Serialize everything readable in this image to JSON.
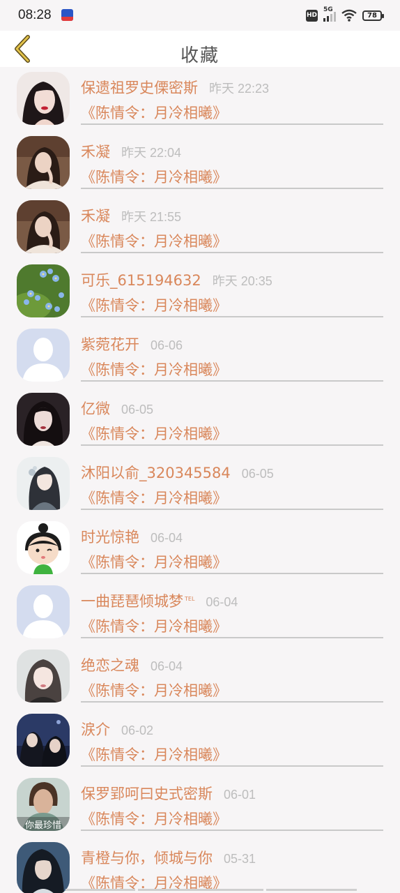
{
  "status_bar": {
    "time": "08:28",
    "hd": "HD",
    "network": "5G",
    "battery": "78"
  },
  "nav": {
    "title": "收藏",
    "back_icon": "chevron-left-icon",
    "back_color": "#d4b13c"
  },
  "colors": {
    "accent": "#d9875b",
    "time_gray": "#bdbdbd",
    "divider": "#c9c9c9"
  },
  "favorites": [
    {
      "name": "保遗祖罗史傈密斯",
      "time": "昨天 22:23",
      "title": "《陈情令：月冷相曦》",
      "avatar": "photo-woman-red-lips"
    },
    {
      "name": "禾凝",
      "time": "昨天 22:04",
      "title": "《陈情令：月冷相曦》",
      "avatar": "photo-woman-hanfu"
    },
    {
      "name": "禾凝",
      "time": "昨天 21:55",
      "title": "《陈情令：月冷相曦》",
      "avatar": "photo-woman-hanfu"
    },
    {
      "name": "可乐_615194632",
      "time": "昨天 20:35",
      "title": "《陈情令：月冷相曦》",
      "avatar": "photo-blue-flowers"
    },
    {
      "name": "紫菀花开",
      "time": "06-06",
      "title": "《陈情令：月冷相曦》",
      "avatar": "default-avatar"
    },
    {
      "name": "亿微",
      "time": "06-05",
      "title": "《陈情令：月冷相曦》",
      "avatar": "photo-woman-dark"
    },
    {
      "name": "沐阳以俞_320345584",
      "time": "06-05",
      "title": "《陈情令：月冷相曦》",
      "avatar": "drawing-ancient-figure"
    },
    {
      "name": "时光惊艳",
      "time": "06-04",
      "title": "《陈情令：月冷相曦》",
      "avatar": "cartoon-girl"
    },
    {
      "name": "一曲琵琶倾城梦",
      "tel": "TEL",
      "time": "06-04",
      "title": "《陈情令：月冷相曦》",
      "avatar": "default-avatar"
    },
    {
      "name": "绝恋之魂",
      "time": "06-04",
      "title": "《陈情令：月冷相曦》",
      "avatar": "photo-woman-bangs"
    },
    {
      "name": "涙介",
      "time": "06-02",
      "title": "《陈情令：月冷相曦》",
      "avatar": "photo-costume-men"
    },
    {
      "name": "保罗郢呵曰史式密斯",
      "time": "06-01",
      "title": "《陈情令：月冷相曦》",
      "avatar": "photo-man-caption",
      "avatar_caption": "你最珍惜"
    },
    {
      "name": "青橙与你，倾城与你",
      "time": "05-31",
      "title": "《陈情令：月冷相曦》",
      "avatar": "photo-costume-man"
    }
  ]
}
